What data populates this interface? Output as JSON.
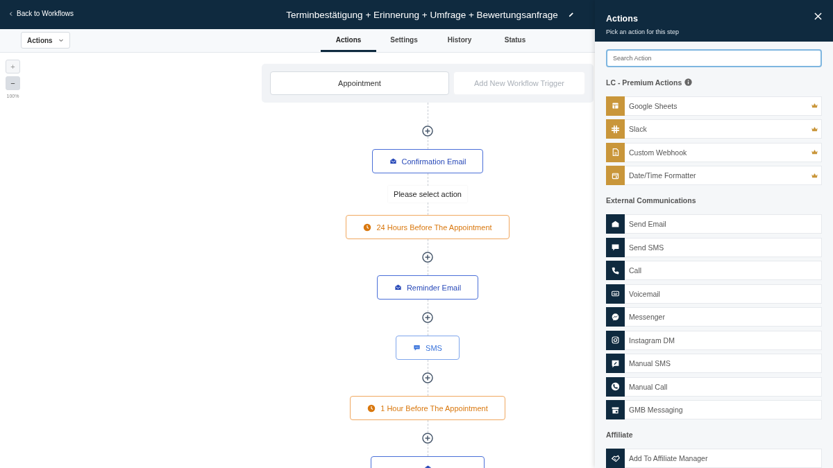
{
  "header": {
    "back_link": "Back to Workflows",
    "title": "Terminbestätigung + Erinnerung + Umfrage + Bewertungsanfrage"
  },
  "toolbar": {
    "actions_menu": "Actions",
    "tabs": [
      {
        "label": "Actions",
        "selected": true
      },
      {
        "label": "Settings",
        "selected": false
      },
      {
        "label": "History",
        "selected": false
      },
      {
        "label": "Status",
        "selected": false
      }
    ]
  },
  "zoom": {
    "level_text": "100%",
    "zoom_in": "+",
    "zoom_out": "−"
  },
  "triggers": {
    "items": [
      {
        "label": "Appointment",
        "kind": "trigger"
      },
      {
        "label": "Add New Workflow Trigger",
        "kind": "add"
      }
    ]
  },
  "flow": [
    {
      "kind": "add"
    },
    {
      "kind": "email",
      "label": "Confirmation Email"
    },
    {
      "kind": "placeholder",
      "label": "Please select action"
    },
    {
      "kind": "wait",
      "label": "24 Hours Before The Appointment"
    },
    {
      "kind": "add"
    },
    {
      "kind": "email",
      "label": "Reminder Email"
    },
    {
      "kind": "add"
    },
    {
      "kind": "sms",
      "label": "SMS"
    },
    {
      "kind": "add"
    },
    {
      "kind": "wait",
      "label": "1 Hour Before The Appointment"
    },
    {
      "kind": "add"
    },
    {
      "kind": "email"
    }
  ],
  "panel": {
    "title": "Actions",
    "subtitle": "Pick an action for this step",
    "search": {
      "placeholder": "Search Action"
    },
    "sections": [
      {
        "title": "LC - Premium Actions",
        "premium": true,
        "items": [
          "Google Sheets",
          "Slack",
          "Custom Webhook",
          "Date/Time Formatter"
        ]
      },
      {
        "title": "External Communications",
        "premium": false,
        "items": [
          "Send Email",
          "Send SMS",
          "Call",
          "Voicemail",
          "Messenger",
          "Instagram DM",
          "Manual SMS",
          "Manual Call",
          "GMB Messaging"
        ]
      },
      {
        "title": "Affiliate",
        "premium": false,
        "items": [
          "Add To Affiliate Manager"
        ]
      }
    ]
  }
}
